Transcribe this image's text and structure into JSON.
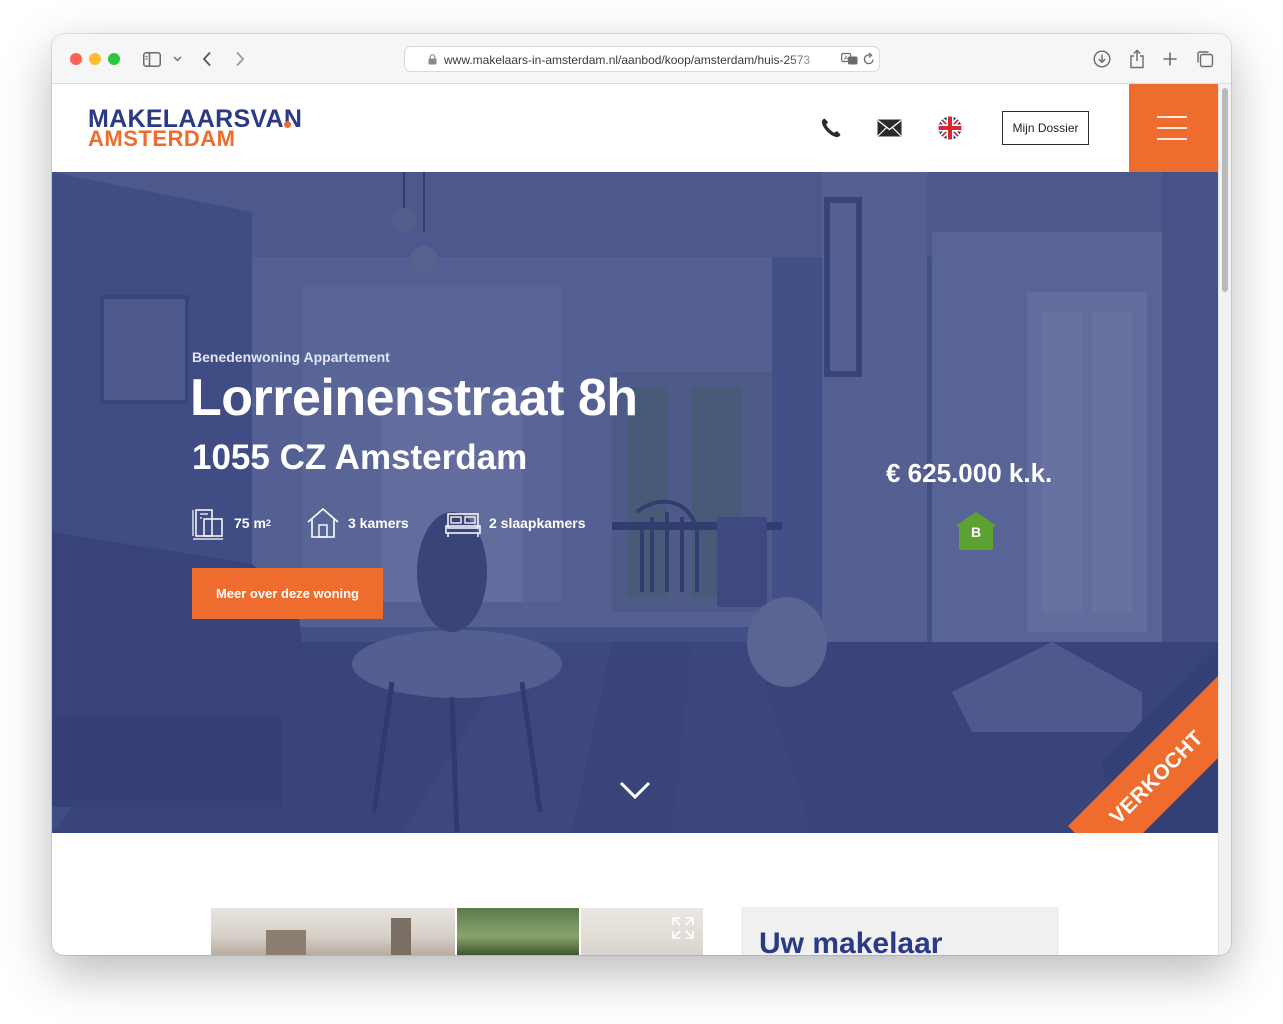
{
  "browser": {
    "url": "www.makelaars-in-amsterdam.nl/aanbod/koop/amsterdam/huis-2573"
  },
  "header": {
    "logo_line1": "MAKELAARSVAN",
    "logo_line2": "AMSTERDAM",
    "dossier_label": "Mijn Dossier"
  },
  "hero": {
    "property_type": "Benedenwoning Appartement",
    "street": "Lorreinenstraat 8h",
    "postal_city": "1055 CZ  Amsterdam",
    "area_value": "75 m",
    "area_sup": "2",
    "rooms": "3 kamers",
    "bedrooms": "2 slaapkamers",
    "cta_label": "Meer over deze woning",
    "price": "€ 625.000 k.k.",
    "energy_label": "B",
    "status_ribbon": "VERKOCHT"
  },
  "below": {
    "makelaar_title": "Uw makelaar"
  },
  "colors": {
    "brand_orange": "#ee6d2e",
    "brand_blue": "#2b3a86",
    "energy_green": "#5da232"
  },
  "icons": [
    "sidebar-icon",
    "back-icon",
    "forward-icon",
    "lock-icon",
    "translate-icon",
    "reload-icon",
    "download-icon",
    "share-icon",
    "new-tab-icon",
    "tabs-icon",
    "phone-icon",
    "mail-icon",
    "uk-flag-icon",
    "menu-icon",
    "area-icon",
    "house-icon",
    "bed-icon",
    "chevron-down-icon",
    "expand-icon"
  ]
}
